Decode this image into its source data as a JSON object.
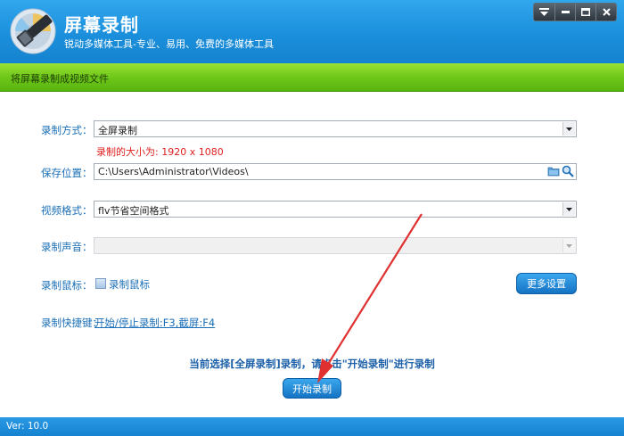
{
  "app": {
    "title": "屏幕录制",
    "subtitle": "锐动多媒体工具-专业、易用、免费的多媒体工具"
  },
  "window_controls": [
    {
      "name": "menu",
      "icon": "menu-dropdown-icon"
    },
    {
      "name": "minimize",
      "icon": "minimize-icon"
    },
    {
      "name": "maximize",
      "icon": "maximize-icon"
    },
    {
      "name": "close",
      "icon": "close-icon"
    }
  ],
  "section": {
    "title": "将屏幕录制成视频文件"
  },
  "form": {
    "record_mode": {
      "label": "录制方式：",
      "value": "全屏录制"
    },
    "size_note": "录制的大小为: 1920 x 1080",
    "save_location": {
      "label": "保存位置：",
      "value": "C:\\Users\\Administrator\\Videos\\"
    },
    "video_format": {
      "label": "视频格式：",
      "value": "flv节省空间格式"
    },
    "audio": {
      "label": "录制声音：",
      "value": ""
    },
    "cursor": {
      "label": "录制鼠标：",
      "checkbox_label": "录制鼠标"
    },
    "hotkey": {
      "label": "录制快捷键：",
      "link": "开始/停止录制:F3,截屏:F4"
    }
  },
  "buttons": {
    "more_settings": "更多设置",
    "start": "开始录制"
  },
  "hint": "当前选择[全屏录制]录制，请点击\"开始录制\"进行录制",
  "status": {
    "version": "Ver: 10.0"
  },
  "colors": {
    "header_blue": "#1b8fdb",
    "green_bar": "#6ec81a",
    "label_blue": "#1a6fb8",
    "note_red": "#e02020",
    "arrow_red": "#e03030"
  }
}
